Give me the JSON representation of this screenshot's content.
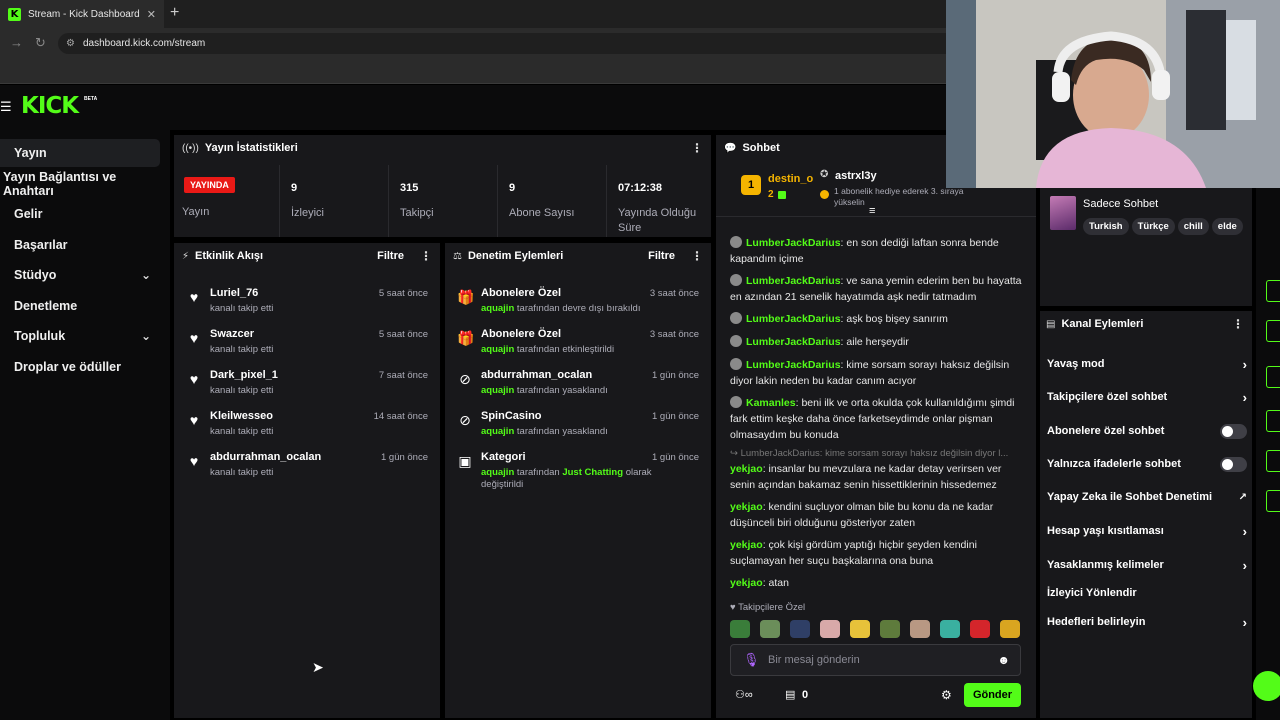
{
  "browser": {
    "tab_title": "Stream - Kick Dashboard",
    "favicon_letter": "K",
    "url": "dashboard.kick.com/stream"
  },
  "header": {
    "logo": "KICK",
    "beta": "BETA"
  },
  "sidebar": {
    "items": [
      {
        "label": "Yayın"
      },
      {
        "label": "Yayın Bağlantısı ve Anahtarı"
      },
      {
        "label": "Gelir"
      },
      {
        "label": "Başarılar"
      },
      {
        "label": "Stüdyo"
      },
      {
        "label": "Denetleme"
      },
      {
        "label": "Topluluk"
      },
      {
        "label": "Droplar ve ödüller"
      }
    ]
  },
  "stats": {
    "title": "Yayın İstatistikleri",
    "live_badge": "YAYINDA",
    "status_label": "Yayın",
    "items": [
      {
        "value": "9",
        "label": "İzleyici"
      },
      {
        "value": "315",
        "label": "Takipçi"
      },
      {
        "value": "9",
        "label": "Abone Sayısı"
      },
      {
        "value": "07:12:38",
        "label": "Yayında Olduğu Süre"
      }
    ]
  },
  "activity": {
    "title": "Etkinlik Akışı",
    "filter": "Filtre",
    "rows": [
      {
        "name": "Luriel_76",
        "sub": "kanalı takip etti",
        "time": "5 saat önce"
      },
      {
        "name": "Swazcer",
        "sub": "kanalı takip etti",
        "time": "5 saat önce"
      },
      {
        "name": "Dark_pixel_1",
        "sub": "kanalı takip etti",
        "time": "7 saat önce"
      },
      {
        "name": "Kleilwesseo",
        "sub": "kanalı takip etti",
        "time": "14 saat önce"
      },
      {
        "name": "abdurrahman_ocalan",
        "sub": "kanalı takip etti",
        "time": "1 gün önce"
      }
    ]
  },
  "moderation": {
    "title": "Denetim Eylemleri",
    "filter": "Filtre",
    "rows": [
      {
        "name": "Abonelere Özel",
        "actor": "aquajin",
        "sub": "tarafından devre dışı bırakıldı",
        "time": "3 saat önce"
      },
      {
        "name": "Abonelere Özel",
        "actor": "aquajin",
        "sub": "tarafından etkinleştirildi",
        "time": "3 saat önce"
      },
      {
        "name": "abdurrahman_ocalan",
        "actor": "aquajin",
        "sub": "tarafından yasaklandı",
        "time": "1 gün önce"
      },
      {
        "name": "SpinCasino",
        "actor": "aquajin",
        "sub": "tarafından yasaklandı",
        "time": "1 gün önce"
      },
      {
        "name": "Kategori",
        "actor": "aquajin",
        "sub": "tarafından",
        "category": "Just Chatting",
        "sub2": "olarak",
        "sub3": "değiştirildi",
        "time": "1 gün önce"
      }
    ]
  },
  "chat": {
    "title": "Sohbet",
    "pinned_user": "destin_o",
    "pinned_count": "2",
    "rank": "1",
    "gift_user": "astrxl3y",
    "gift_text": "1 abonelik hediye ederek 3. sıraya yükselin",
    "messages": [
      {
        "user": "LumberJackDarius",
        "text": "en son dediği laftan sonra bende kapandım içime"
      },
      {
        "user": "LumberJackDarius",
        "text": "ve sana yemin ederim ben bu hayatta en azından 21 senelik hayatımda aşk nedir tatmadım"
      },
      {
        "user": "LumberJackDarius",
        "text": "aşk boş bişey sanırım"
      },
      {
        "user": "LumberJackDarius",
        "text": "aile herşeydir"
      },
      {
        "user": "LumberJackDarius",
        "text": "kime sorsam sorayı haksız değilsin diyor lakin neden bu kadar canım acıyor"
      },
      {
        "user": "Kamanles",
        "text": "beni ilk ve orta okulda çok kullanıldığımı şimdi fark ettim keşke daha önce farketseydimde onlar pişman olmasaydım bu konuda"
      },
      {
        "reply": "LumberJackDarius: kime sorsam sorayı haksız değilsin diyor l...",
        "user": "yekjao",
        "text": "insanlar bu mevzulara ne kadar detay verirsen ver senin açından bakamaz senin hissettiklerinin hissedemez"
      },
      {
        "user": "yekjao",
        "text": "kendini suçluyor olman bile bu konu da ne kadar düşünceli biri olduğunu gösteriyor zaten"
      },
      {
        "user": "yekjao",
        "text": "çok kişi gördüm yaptığı hiçbir şeyden kendini suçlamayan her suçu başkalarına ona buna"
      },
      {
        "user": "yekjao",
        "text": "atan"
      }
    ],
    "followers_only": "Takipçilere Özel",
    "input_placeholder": "Bir mesaj gönderin",
    "points": "0",
    "send": "Gönder"
  },
  "channel_info": {
    "title": "Sadece Sohbet",
    "tags": [
      "Turkish",
      "Türkçe",
      "chill",
      "elde"
    ]
  },
  "channel_actions": {
    "title": "Kanal Eylemleri",
    "items": [
      {
        "label": "Yavaş mod",
        "control": "chevron"
      },
      {
        "label": "Takipçilere özel sohbet",
        "control": "chevron"
      },
      {
        "label": "Abonelere özel sohbet",
        "control": "toggle"
      },
      {
        "label": "Yalnızca ifadelerle sohbet",
        "control": "toggle"
      },
      {
        "label": "Yapay Zeka ile Sohbet Denetimi",
        "control": "external"
      },
      {
        "label": "Hesap yaşı kısıtlaması",
        "control": "chevron"
      },
      {
        "label": "Yasaklanmış kelimeler",
        "control": "chevron"
      },
      {
        "label": "İzleyici Yönlendir",
        "control": "none"
      },
      {
        "label": "Hedefleri belirleyin",
        "control": "chevron"
      }
    ]
  },
  "colors": {
    "accent": "#53fc18",
    "live": "#e91916",
    "panel": "#18181b",
    "background": "#000000"
  }
}
